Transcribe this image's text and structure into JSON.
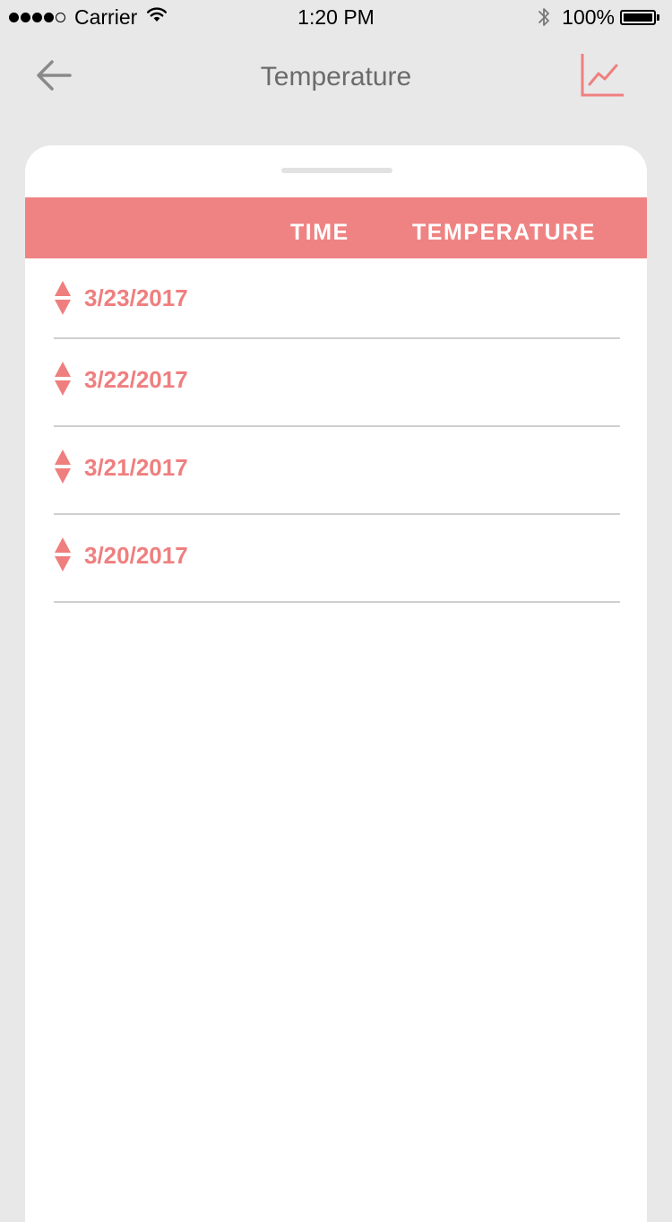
{
  "status_bar": {
    "carrier": "Carrier",
    "time": "1:20 PM",
    "battery": "100%",
    "signal_bars_filled": 4,
    "signal_bars_total": 5
  },
  "nav": {
    "title": "Temperature",
    "back_icon": "arrow-left-icon",
    "chart_icon": "line-chart-icon"
  },
  "table": {
    "headers": {
      "time": "TIME",
      "temperature": "TEMPERATURE"
    },
    "rows": [
      {
        "date": "3/23/2017"
      },
      {
        "date": "3/22/2017"
      },
      {
        "date": "3/21/2017"
      },
      {
        "date": "3/20/2017"
      }
    ]
  },
  "colors": {
    "accent": "#ef8383",
    "date_text": "#ef7f7f",
    "background": "#e8e8e8",
    "card": "#ffffff",
    "divider": "#cfcfcf"
  }
}
